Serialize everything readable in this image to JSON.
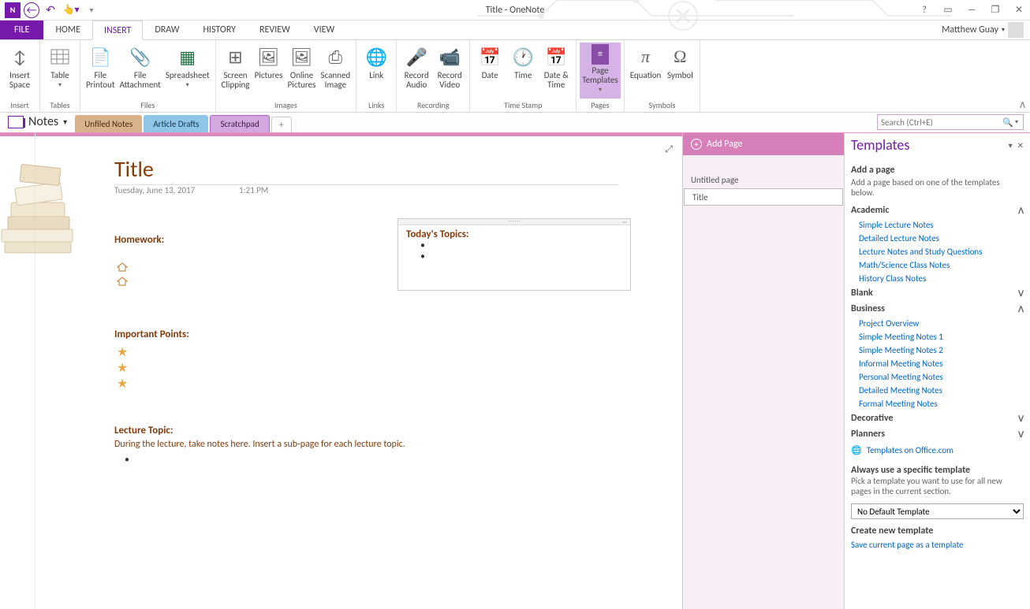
{
  "app_title": "Title - OneNote",
  "user_name": "Matthew Guay",
  "ribbon_tabs": {
    "file": "FILE",
    "home": "HOME",
    "insert": "INSERT",
    "draw": "DRAW",
    "history": "HISTORY",
    "review": "REVIEW",
    "view": "VIEW"
  },
  "ribbon": {
    "insert_space": "Insert\nSpace",
    "table": "Table",
    "file_printout": "File\nPrintout",
    "file_attachment": "File\nAttachment",
    "spreadsheet": "Spreadsheet",
    "screen_clipping": "Screen\nClipping",
    "pictures": "Pictures",
    "online_pictures": "Online\nPictures",
    "scanned_image": "Scanned\nImage",
    "link": "Link",
    "record_audio": "Record\nAudio",
    "record_video": "Record\nVideo",
    "date": "Date",
    "time": "Time",
    "date_time": "Date &\nTime",
    "page_templates": "Page\nTemplates",
    "equation": "Equation",
    "symbol": "Symbol",
    "groups": {
      "insert": "Insert",
      "tables": "Tables",
      "files": "Files",
      "images": "Images",
      "links": "Links",
      "recording": "Recording",
      "time_stamp": "Time Stamp",
      "pages": "Pages",
      "symbols": "Symbols"
    }
  },
  "notebook_name": "Notes",
  "sections": {
    "unfiled": "Unfiled Notes",
    "drafts": "Article Drafts",
    "scratch": "Scratchpad"
  },
  "search_placeholder": "Search (Ctrl+E)",
  "add_page_label": "Add Page",
  "pages": {
    "p1": "Untitled page",
    "p2": "Title"
  },
  "page": {
    "title": "Title",
    "date": "Tuesday, June 13, 2017",
    "time": "1:21 PM",
    "homework": "Homework:",
    "important": "Important Points:",
    "lecture_topic": "Lecture Topic:",
    "lecture_hint": "During the lecture, take notes here.  Insert a sub-page for each lecture topic.",
    "todays_topics": "Today's Topics:"
  },
  "templates": {
    "title": "Templates",
    "add_page": "Add a page",
    "add_page_hint": "Add a page based on one of the templates below.",
    "cat_academic": "Academic",
    "academic": {
      "simple_lecture": "Simple Lecture Notes",
      "detailed_lecture": "Detailed Lecture Notes",
      "lecture_study": "Lecture Notes and Study Questions",
      "math_science": "Math/Science Class Notes",
      "history": "History Class Notes"
    },
    "cat_blank": "Blank",
    "cat_business": "Business",
    "business": {
      "project_overview": "Project Overview",
      "simple_meeting1": "Simple Meeting Notes 1",
      "simple_meeting2": "Simple Meeting Notes 2",
      "informal": "Informal Meeting Notes",
      "personal": "Personal Meeting Notes",
      "detailed": "Detailed Meeting Notes",
      "formal": "Formal Meeting Notes"
    },
    "cat_decorative": "Decorative",
    "cat_planners": "Planners",
    "office_link": "Templates on Office.com",
    "always_title": "Always use a specific template",
    "always_hint": "Pick a template you want to use for all new pages in the current section.",
    "default_option": "No Default Template",
    "create_title": "Create new template",
    "save_link": "Save current page as a template"
  }
}
